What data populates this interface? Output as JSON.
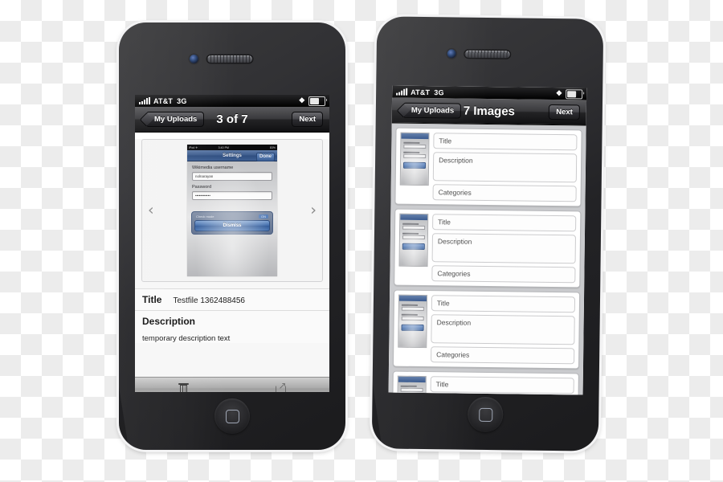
{
  "left_phone": {
    "status_bar": {
      "carrier": "AT&T",
      "network": "3G",
      "bluetooth_icon": "bluetooth-icon",
      "battery_icon": "battery-icon"
    },
    "nav": {
      "back_label": "My Uploads",
      "title": "3 of 7",
      "next_label": "Next"
    },
    "preview": {
      "prev_arrow": "‹",
      "next_arrow": "›",
      "screenshot": {
        "status_left": "iPod ✈",
        "status_center": "3:40 PM",
        "status_right": "83%",
        "nav_title": "Settings",
        "done_label": "Done",
        "username_label": "Wikimedia username",
        "username_value": "nolnarayan",
        "password_label": "Password",
        "password_value": "••••••••••••",
        "alert_title": "Check mode",
        "alert_badge": "ON",
        "dismiss_label": "Dismiss"
      }
    },
    "meta": {
      "title_label": "Title",
      "title_value": "Testfile 1362488456",
      "description_label": "Description",
      "description_value": "temporary description text"
    },
    "toolbar": {
      "delete_icon": "trash-icon",
      "share_icon": "share-icon"
    }
  },
  "right_phone": {
    "status_bar": {
      "carrier": "AT&T",
      "network": "3G",
      "bluetooth_icon": "bluetooth-icon",
      "battery_icon": "battery-icon"
    },
    "nav": {
      "back_label": "My Uploads",
      "title": "7 Images",
      "next_label": "Next"
    },
    "rows": [
      {
        "title": "Title",
        "description": "Description",
        "categories": "Categories"
      },
      {
        "title": "Title",
        "description": "Description",
        "categories": "Categories"
      },
      {
        "title": "Title",
        "description": "Description",
        "categories": "Categories"
      },
      {
        "title": "Title",
        "description": "",
        "categories": ""
      }
    ]
  }
}
